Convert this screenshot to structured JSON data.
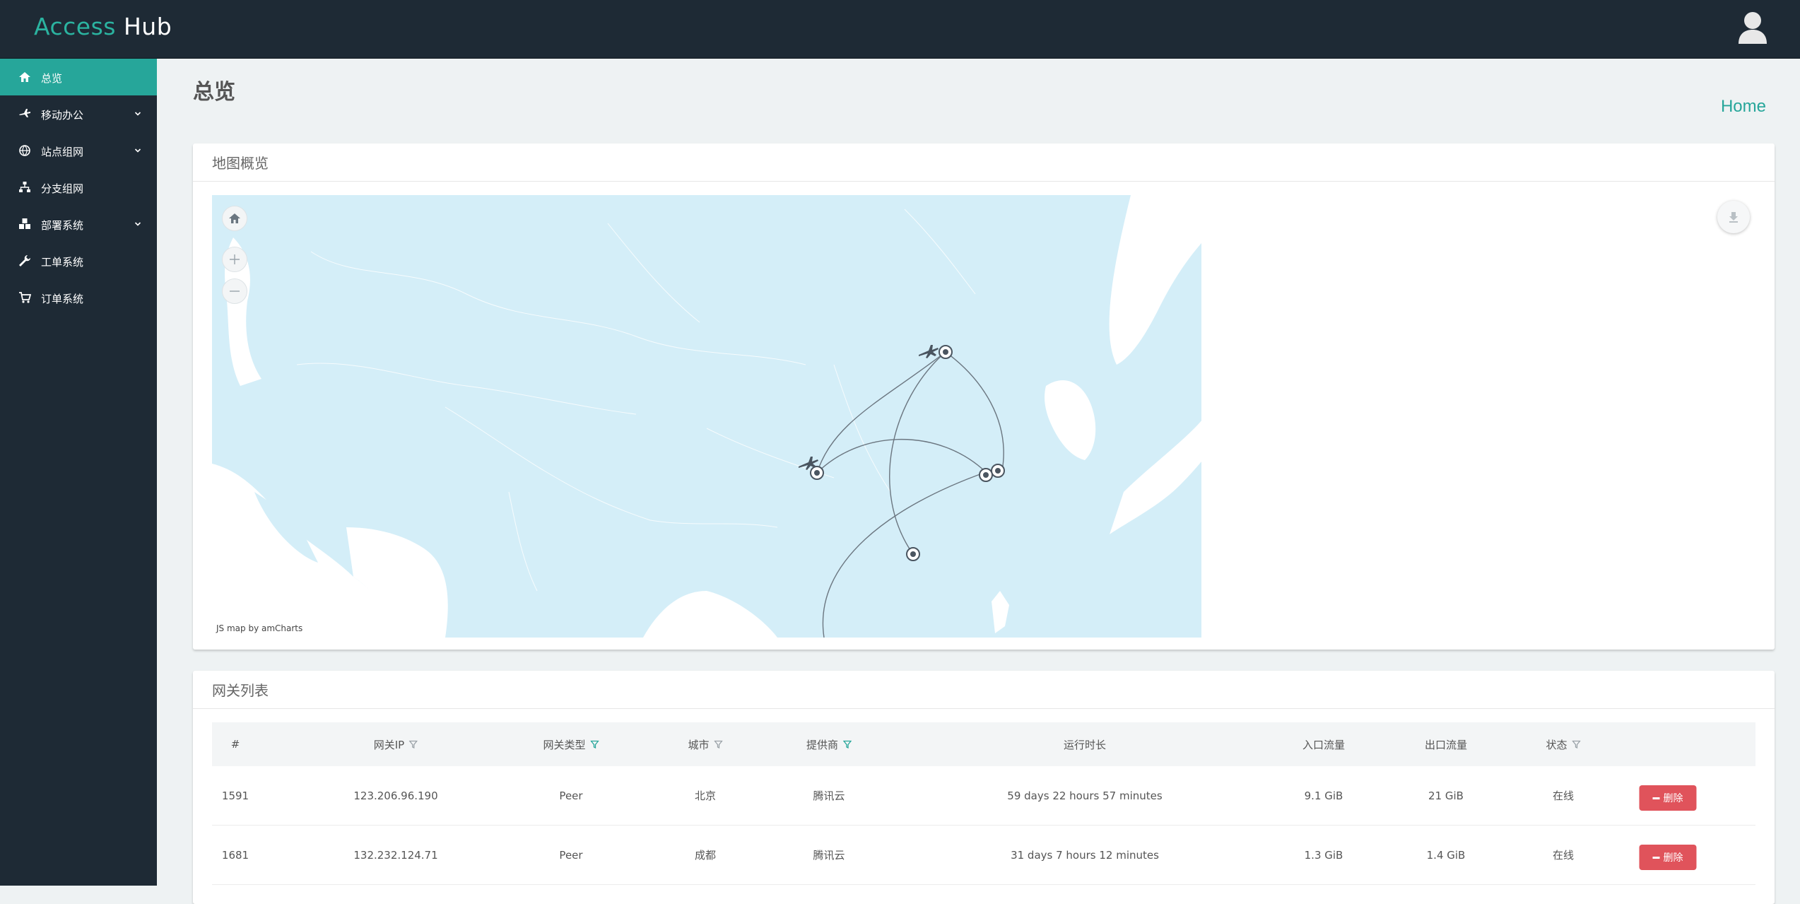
{
  "brand": {
    "part1": "Access",
    "part2": "Hub"
  },
  "sidebar": {
    "items": [
      {
        "label": "总览",
        "icon": "home-icon",
        "active": true,
        "expandable": false
      },
      {
        "label": "移动办公",
        "icon": "plane-icon",
        "active": false,
        "expandable": true
      },
      {
        "label": "站点组网",
        "icon": "globe-icon",
        "active": false,
        "expandable": true
      },
      {
        "label": "分支组网",
        "icon": "sitemap-icon",
        "active": false,
        "expandable": false
      },
      {
        "label": "部署系统",
        "icon": "cubes-icon",
        "active": false,
        "expandable": true
      },
      {
        "label": "工单系统",
        "icon": "wrench-icon",
        "active": false,
        "expandable": false
      },
      {
        "label": "订单系统",
        "icon": "cart-icon",
        "active": false,
        "expandable": false
      }
    ]
  },
  "page": {
    "title": "总览",
    "breadcrumb": "Home"
  },
  "map_card": {
    "title": "地图概览",
    "credit": "JS map by amCharts"
  },
  "table_card": {
    "title": "网关列表",
    "columns": [
      {
        "label": "#",
        "filter": false,
        "filter_active": false
      },
      {
        "label": "网关IP",
        "filter": true,
        "filter_active": false
      },
      {
        "label": "网关类型",
        "filter": true,
        "filter_active": true
      },
      {
        "label": "城市",
        "filter": true,
        "filter_active": false
      },
      {
        "label": "提供商",
        "filter": true,
        "filter_active": true
      },
      {
        "label": "运行时长",
        "filter": false,
        "filter_active": false
      },
      {
        "label": "入口流量",
        "filter": false,
        "filter_active": false
      },
      {
        "label": "出口流量",
        "filter": false,
        "filter_active": false
      },
      {
        "label": "状态",
        "filter": true,
        "filter_active": false
      }
    ],
    "rows": [
      {
        "id": "1591",
        "ip": "123.206.96.190",
        "type": "Peer",
        "city": "北京",
        "provider": "腾讯云",
        "uptime": "59 days 22 hours 57 minutes",
        "ingress": "9.1 GiB",
        "egress": "21 GiB",
        "status": "在线",
        "action": "删除"
      },
      {
        "id": "1681",
        "ip": "132.232.124.71",
        "type": "Peer",
        "city": "成都",
        "provider": "腾讯云",
        "uptime": "31 days 7 hours 12 minutes",
        "ingress": "1.3 GiB",
        "egress": "1.4 GiB",
        "status": "在线",
        "action": "删除"
      }
    ]
  },
  "colors": {
    "accent": "#26a69a",
    "topbar": "#1e2a35",
    "danger": "#e0535b",
    "sea": "#d4eef8",
    "filter_active": "#26a69a"
  }
}
